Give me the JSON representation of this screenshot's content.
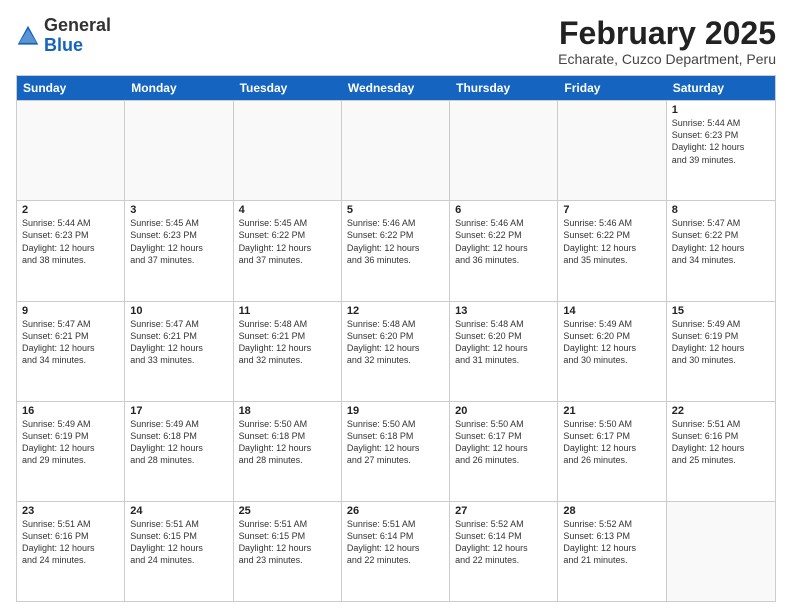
{
  "header": {
    "logo_general": "General",
    "logo_blue": "Blue",
    "month_title": "February 2025",
    "location": "Echarate, Cuzco Department, Peru"
  },
  "weekdays": [
    "Sunday",
    "Monday",
    "Tuesday",
    "Wednesday",
    "Thursday",
    "Friday",
    "Saturday"
  ],
  "weeks": [
    [
      {
        "day": "",
        "info": "",
        "empty": true
      },
      {
        "day": "",
        "info": "",
        "empty": true
      },
      {
        "day": "",
        "info": "",
        "empty": true
      },
      {
        "day": "",
        "info": "",
        "empty": true
      },
      {
        "day": "",
        "info": "",
        "empty": true
      },
      {
        "day": "",
        "info": "",
        "empty": true
      },
      {
        "day": "1",
        "info": "Sunrise: 5:44 AM\nSunset: 6:23 PM\nDaylight: 12 hours\nand 39 minutes.",
        "empty": false
      }
    ],
    [
      {
        "day": "2",
        "info": "Sunrise: 5:44 AM\nSunset: 6:23 PM\nDaylight: 12 hours\nand 38 minutes.",
        "empty": false
      },
      {
        "day": "3",
        "info": "Sunrise: 5:45 AM\nSunset: 6:23 PM\nDaylight: 12 hours\nand 37 minutes.",
        "empty": false
      },
      {
        "day": "4",
        "info": "Sunrise: 5:45 AM\nSunset: 6:22 PM\nDaylight: 12 hours\nand 37 minutes.",
        "empty": false
      },
      {
        "day": "5",
        "info": "Sunrise: 5:46 AM\nSunset: 6:22 PM\nDaylight: 12 hours\nand 36 minutes.",
        "empty": false
      },
      {
        "day": "6",
        "info": "Sunrise: 5:46 AM\nSunset: 6:22 PM\nDaylight: 12 hours\nand 36 minutes.",
        "empty": false
      },
      {
        "day": "7",
        "info": "Sunrise: 5:46 AM\nSunset: 6:22 PM\nDaylight: 12 hours\nand 35 minutes.",
        "empty": false
      },
      {
        "day": "8",
        "info": "Sunrise: 5:47 AM\nSunset: 6:22 PM\nDaylight: 12 hours\nand 34 minutes.",
        "empty": false
      }
    ],
    [
      {
        "day": "9",
        "info": "Sunrise: 5:47 AM\nSunset: 6:21 PM\nDaylight: 12 hours\nand 34 minutes.",
        "empty": false
      },
      {
        "day": "10",
        "info": "Sunrise: 5:47 AM\nSunset: 6:21 PM\nDaylight: 12 hours\nand 33 minutes.",
        "empty": false
      },
      {
        "day": "11",
        "info": "Sunrise: 5:48 AM\nSunset: 6:21 PM\nDaylight: 12 hours\nand 32 minutes.",
        "empty": false
      },
      {
        "day": "12",
        "info": "Sunrise: 5:48 AM\nSunset: 6:20 PM\nDaylight: 12 hours\nand 32 minutes.",
        "empty": false
      },
      {
        "day": "13",
        "info": "Sunrise: 5:48 AM\nSunset: 6:20 PM\nDaylight: 12 hours\nand 31 minutes.",
        "empty": false
      },
      {
        "day": "14",
        "info": "Sunrise: 5:49 AM\nSunset: 6:20 PM\nDaylight: 12 hours\nand 30 minutes.",
        "empty": false
      },
      {
        "day": "15",
        "info": "Sunrise: 5:49 AM\nSunset: 6:19 PM\nDaylight: 12 hours\nand 30 minutes.",
        "empty": false
      }
    ],
    [
      {
        "day": "16",
        "info": "Sunrise: 5:49 AM\nSunset: 6:19 PM\nDaylight: 12 hours\nand 29 minutes.",
        "empty": false
      },
      {
        "day": "17",
        "info": "Sunrise: 5:49 AM\nSunset: 6:18 PM\nDaylight: 12 hours\nand 28 minutes.",
        "empty": false
      },
      {
        "day": "18",
        "info": "Sunrise: 5:50 AM\nSunset: 6:18 PM\nDaylight: 12 hours\nand 28 minutes.",
        "empty": false
      },
      {
        "day": "19",
        "info": "Sunrise: 5:50 AM\nSunset: 6:18 PM\nDaylight: 12 hours\nand 27 minutes.",
        "empty": false
      },
      {
        "day": "20",
        "info": "Sunrise: 5:50 AM\nSunset: 6:17 PM\nDaylight: 12 hours\nand 26 minutes.",
        "empty": false
      },
      {
        "day": "21",
        "info": "Sunrise: 5:50 AM\nSunset: 6:17 PM\nDaylight: 12 hours\nand 26 minutes.",
        "empty": false
      },
      {
        "day": "22",
        "info": "Sunrise: 5:51 AM\nSunset: 6:16 PM\nDaylight: 12 hours\nand 25 minutes.",
        "empty": false
      }
    ],
    [
      {
        "day": "23",
        "info": "Sunrise: 5:51 AM\nSunset: 6:16 PM\nDaylight: 12 hours\nand 24 minutes.",
        "empty": false
      },
      {
        "day": "24",
        "info": "Sunrise: 5:51 AM\nSunset: 6:15 PM\nDaylight: 12 hours\nand 24 minutes.",
        "empty": false
      },
      {
        "day": "25",
        "info": "Sunrise: 5:51 AM\nSunset: 6:15 PM\nDaylight: 12 hours\nand 23 minutes.",
        "empty": false
      },
      {
        "day": "26",
        "info": "Sunrise: 5:51 AM\nSunset: 6:14 PM\nDaylight: 12 hours\nand 22 minutes.",
        "empty": false
      },
      {
        "day": "27",
        "info": "Sunrise: 5:52 AM\nSunset: 6:14 PM\nDaylight: 12 hours\nand 22 minutes.",
        "empty": false
      },
      {
        "day": "28",
        "info": "Sunrise: 5:52 AM\nSunset: 6:13 PM\nDaylight: 12 hours\nand 21 minutes.",
        "empty": false
      },
      {
        "day": "",
        "info": "",
        "empty": true
      }
    ]
  ]
}
